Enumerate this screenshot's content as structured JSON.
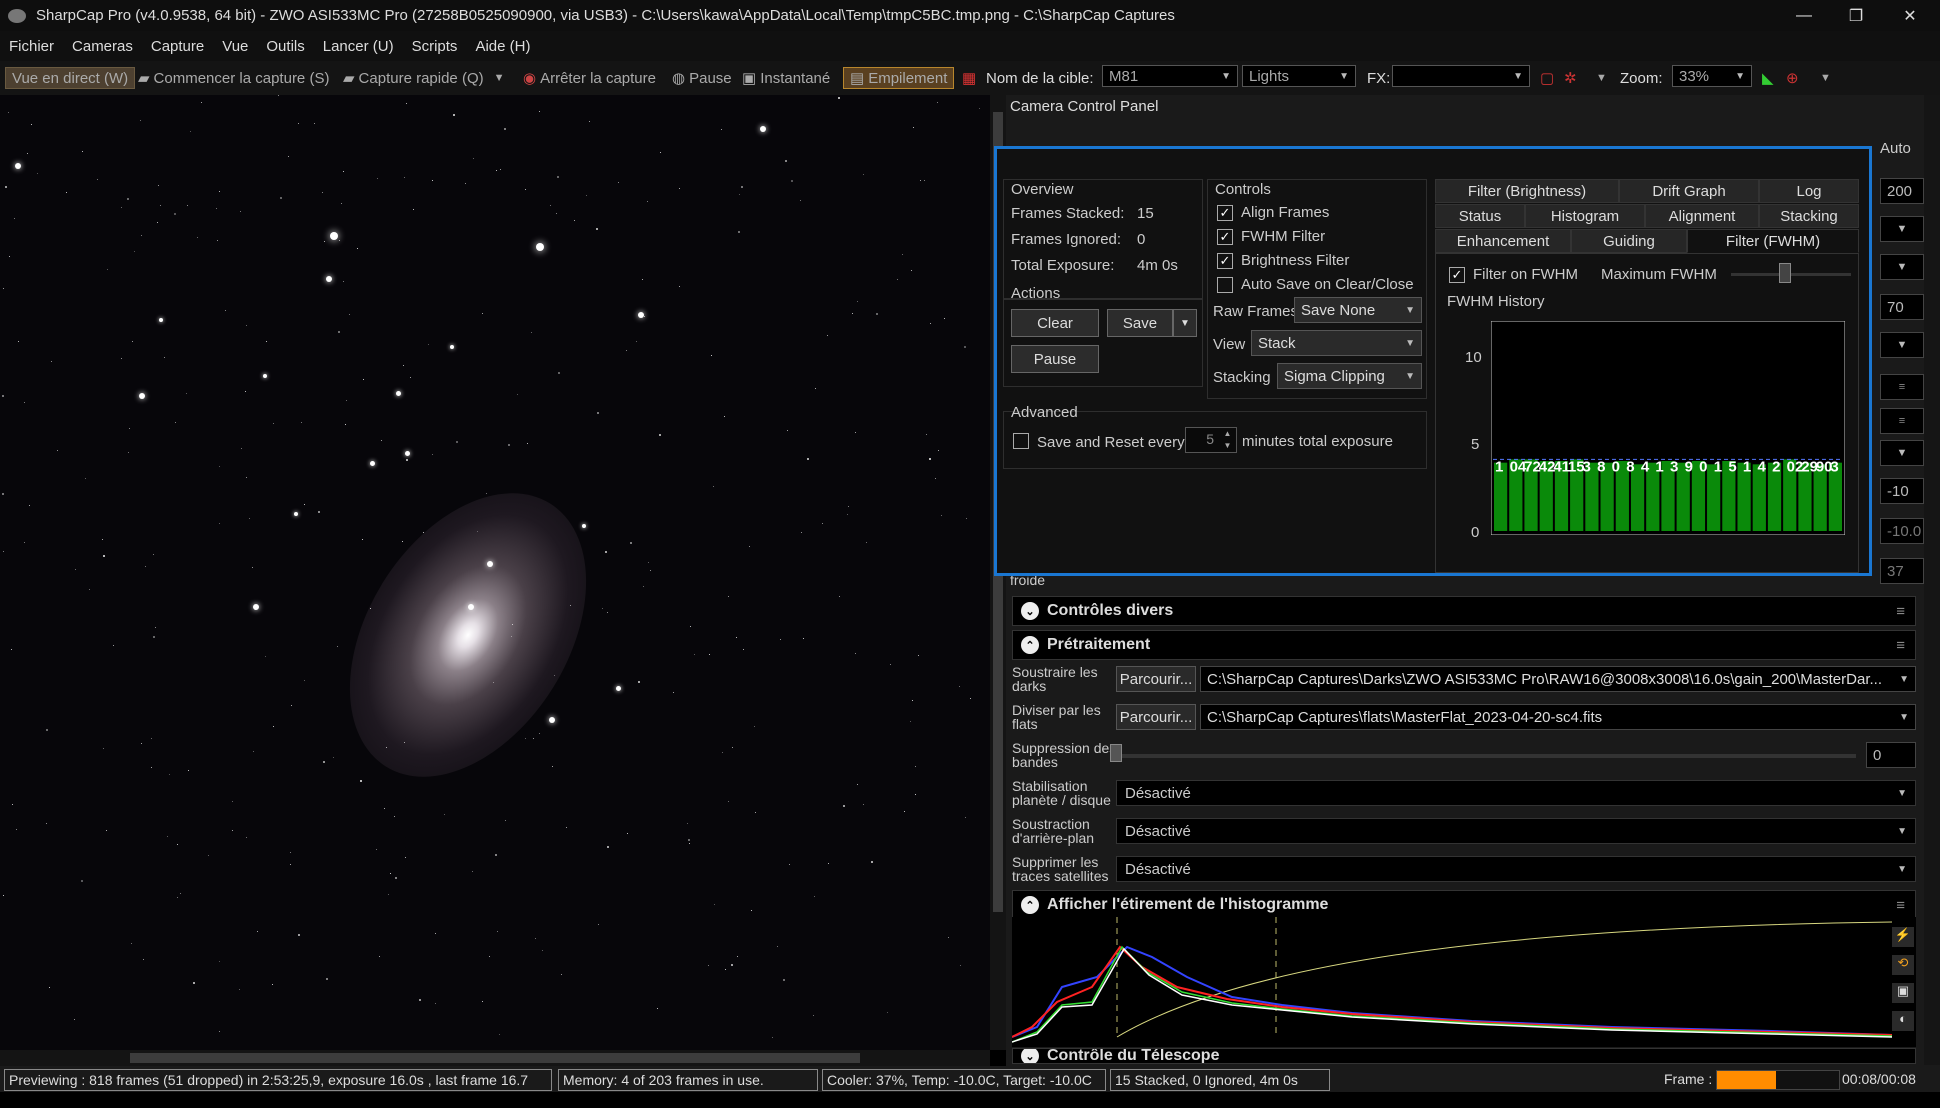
{
  "window": {
    "title": "SharpCap Pro (v4.0.9538, 64 bit) - ZWO ASI533MC Pro (27258B0525090900, via USB3) - C:\\Users\\kawa\\AppData\\Local\\Temp\\tmpC5BC.tmp.png - C:\\SharpCap Captures",
    "minimize": "—",
    "restore": "❐",
    "close": "✕"
  },
  "menu": [
    "Fichier",
    "Cameras",
    "Capture",
    "Vue",
    "Outils",
    "Lancer (U)",
    "Scripts",
    "Aide (H)"
  ],
  "toolbar": {
    "live": "Vue en direct (W)",
    "start_capture": "Commencer la capture (S)",
    "quick_capture": "Capture rapide (Q)",
    "stop_capture": "Arrêter la capture",
    "pause": "Pause",
    "snapshot": "Instantané",
    "stacking": "Empilement",
    "target_label": "Nom de la cible:",
    "target_value": "M81",
    "frame_type": "Lights",
    "fx_label": "FX:",
    "fx_value": "",
    "zoom_label": "Zoom:",
    "zoom_value": "33%"
  },
  "panel": {
    "title": "Camera Control Panel",
    "auto": "Auto",
    "side_values": [
      "200",
      "70",
      "-10",
      "-10.0",
      "37"
    ],
    "froide": "froide"
  },
  "popup": {
    "overview": {
      "title": "Overview",
      "stacked_label": "Frames Stacked:",
      "stacked": "15",
      "ignored_label": "Frames Ignored:",
      "ignored": "0",
      "exposure_label": "Total Exposure:",
      "exposure": "4m 0s"
    },
    "actions": {
      "title": "Actions",
      "clear": "Clear",
      "save": "Save",
      "pause": "Pause"
    },
    "advanced": {
      "title": "Advanced",
      "save_reset": "Save and Reset every",
      "minutes": "5",
      "minutes_suffix": "minutes total exposure"
    },
    "controls": {
      "title": "Controls",
      "align": "Align Frames",
      "fwhm": "FWHM Filter",
      "brightness": "Brightness Filter",
      "autosave": "Auto Save on Clear/Close",
      "raw_label": "Raw Frames",
      "raw_value": "Save None",
      "view_label": "View",
      "view_value": "Stack",
      "stacking_label": "Stacking",
      "stacking_value": "Sigma Clipping"
    },
    "tabs_row1": [
      "Filter (Brightness)",
      "Drift Graph",
      "Log"
    ],
    "tabs_row2": [
      "Status",
      "Histogram",
      "Alignment",
      "Stacking"
    ],
    "tabs_row3": [
      "Enhancement",
      "Guiding",
      "Filter (FWHM)"
    ],
    "fwhm": {
      "filter_on": "Filter on FWHM",
      "max_label": "Maximum FWHM",
      "history": "FWHM History",
      "yticks": [
        "10",
        "5",
        "0"
      ]
    }
  },
  "chart_data": {
    "type": "bar",
    "title": "FWHM History",
    "ylim": [
      0,
      12
    ],
    "values": [
      4.1,
      4.3,
      4.3,
      4.2,
      4.2,
      4.3,
      4.1,
      4.1,
      4.2,
      4.0,
      4.1,
      4.2,
      4.1,
      4.2,
      4.0,
      4.2,
      4.1,
      4.0,
      4.1,
      4.3,
      4.1,
      4.0,
      4.1
    ],
    "labels": [
      "1",
      "04",
      "72",
      "42",
      "41",
      "15",
      "3",
      "8",
      "0",
      "8",
      "4",
      "1",
      "3",
      "9",
      "0",
      "1",
      "5",
      "1",
      "4",
      "2",
      "02",
      "29",
      "90",
      "3"
    ],
    "threshold": 4.3,
    "color": "#0a8a0a"
  },
  "sections": {
    "misc": "Contrôles divers",
    "preproc": "Prétraitement",
    "hist": "Afficher l'étirement de l'histogramme",
    "telescope": "Contrôle du Télescope"
  },
  "preproc": {
    "darks_label": "Soustraire les darks",
    "browse": "Parcourir...",
    "darks_path": "C:\\SharpCap Captures\\Darks\\ZWO ASI533MC Pro\\RAW16@3008x3008\\16.0s\\gain_200\\MasterDar...",
    "flats_label": "Diviser par les flats",
    "flats_path": "C:\\SharpCap Captures\\flats\\MasterFlat_2023-04-20-sc4.fits",
    "banding_label": "Suppression des bandes",
    "banding_value": "0",
    "stab_label": "Stabilisation planète / disque",
    "bg_label": "Soustraction d'arrière-plan",
    "sat_label": "Supprimer les traces satellites",
    "off": "Désactivé"
  },
  "status": {
    "preview": "Previewing : 818 frames (51 dropped) in 2:53:25,9, exposure 16.0s , last frame 16.7",
    "memory": "Memory: 4 of 203 frames in use.",
    "cooler": "Cooler: 37%, Temp: -10.0C, Target: -10.0C",
    "stack": "15 Stacked, 0 Ignored, 4m 0s",
    "frame_label": "Frame :",
    "frame_time": "00:08/00:08"
  },
  "colors": {
    "accent": "#1a77d2",
    "bar": "#0a8a0a",
    "progress": "#ff8c00"
  }
}
